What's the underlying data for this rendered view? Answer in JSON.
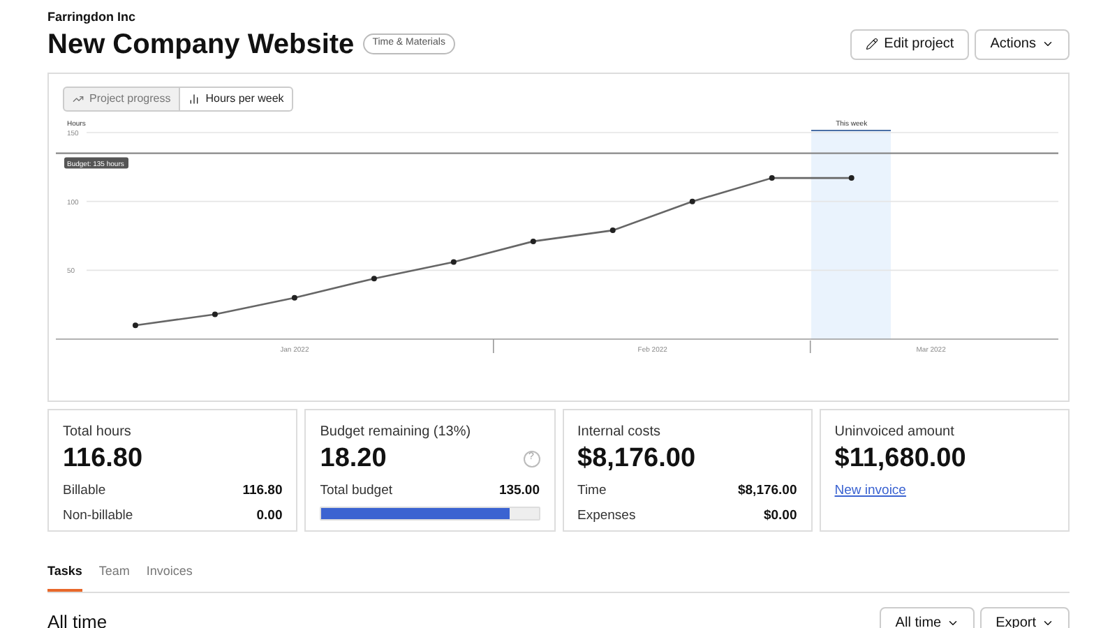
{
  "header": {
    "client": "Farringdon Inc",
    "title": "New Company Website",
    "badge": "Time & Materials",
    "buttons": [
      {
        "kind": "edit",
        "label": "Edit project"
      },
      {
        "kind": "menu",
        "label": "Actions"
      }
    ]
  },
  "chart_toggle": [
    {
      "kind": "line",
      "label": "Project progress",
      "selected": true
    },
    {
      "kind": "bars",
      "label": "Hours per week",
      "selected": false
    }
  ],
  "chart": {
    "chart_data": {
      "type": "line",
      "categories": [
        null,
        null,
        null,
        null,
        null,
        null,
        null,
        null,
        null,
        null
      ],
      "ylim": [
        0,
        150
      ],
      "yticks": [
        50,
        100,
        150
      ],
      "series": [
        {
          "name": "Hours",
          "color": "#666666",
          "marker": true,
          "values": [
            10,
            18,
            30,
            44,
            56,
            71,
            79,
            100,
            117,
            117
          ]
        }
      ],
      "ref_lines": [
        {
          "axis": "y",
          "value": 135
        }
      ],
      "annotations": [
        "Budget: 135 hours",
        "This week"
      ]
    },
    "month_labels": [
      "Jan 2022",
      "Feb 2022",
      "Mar 2022"
    ]
  },
  "stats": [
    {
      "kind": "rows",
      "title": "Total hours",
      "value": "116.80",
      "rows": [
        {
          "label": "Billable",
          "value": "116.80"
        },
        {
          "label": "Non-billable",
          "value": "0.00"
        }
      ]
    },
    {
      "kind": "budget",
      "title": "Budget remaining (13%)",
      "value": "18.20",
      "help": "?",
      "rows": [
        {
          "label": "Total budget",
          "value": "135.00"
        }
      ],
      "level": 0.865
    },
    {
      "kind": "rows",
      "title": "Internal costs",
      "value": "$8,176.00",
      "rows": [
        {
          "label": "Time",
          "value": "$8,176.00"
        },
        {
          "label": "Expenses",
          "value": "$0.00"
        }
      ]
    },
    {
      "kind": "link",
      "title": "Uninvoiced amount",
      "value": "$11,680.00",
      "link": "New invoice"
    }
  ],
  "tabs": [
    {
      "label": "Tasks",
      "selected": true
    },
    {
      "label": "Team",
      "selected": false
    },
    {
      "label": "Invoices",
      "selected": false
    }
  ],
  "section": {
    "title": "All time",
    "buttons": [
      "All time",
      "Export"
    ]
  }
}
